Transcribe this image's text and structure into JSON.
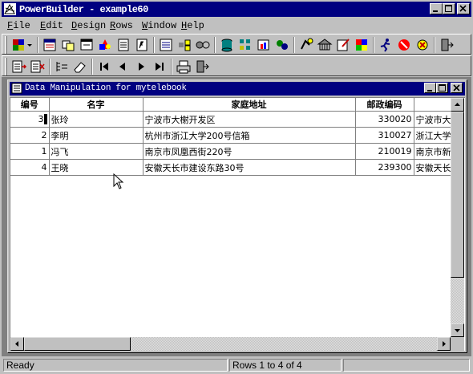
{
  "window": {
    "title": "PowerBuilder - example60",
    "app_icon": "powerbuilder-icon"
  },
  "menu": [
    {
      "label": "File",
      "key": "F",
      "rest": "ile"
    },
    {
      "label": "Edit",
      "key": "E",
      "rest": "dit"
    },
    {
      "label": "Design",
      "key": "D",
      "rest": "esign"
    },
    {
      "label": "Rows",
      "key": "R",
      "rest": "ows"
    },
    {
      "label": "Window",
      "key": "W",
      "rest": "indow"
    },
    {
      "label": "Help",
      "key": "H",
      "rest": "elp"
    }
  ],
  "toolbar1_icons": [
    "painterbar-icon",
    "datawindow-icon",
    "application-icon",
    "window-icon",
    "menu-icon",
    "structure-icon",
    "function-icon",
    "library-icon",
    "query-icon",
    "pipeline-icon",
    "database-icon",
    "dbprofile-icon",
    "project-icon",
    "userobject-icon",
    "run-icon",
    "debug-icon",
    "object-browser-icon",
    "edit-icon",
    "color-icon",
    "run-window-icon",
    "stop-icon",
    "preview-icon",
    "exit-icon"
  ],
  "toolbar2_icons": [
    "insert-row-icon",
    "delete-row-icon",
    "filter-icon",
    "eraser-icon",
    "first-page-icon",
    "prior-page-icon",
    "next-page-icon",
    "last-page-icon",
    "print-icon",
    "close-preview-icon"
  ],
  "child_window": {
    "title": "Data Manipulation for mytelebook"
  },
  "table": {
    "columns": [
      "编号",
      "名字",
      "家庭地址",
      "邮政编码",
      ""
    ],
    "rows": [
      {
        "id": "3",
        "name": "张玲",
        "address": "宁波市大榭开发区",
        "zip": "330020",
        "extra": "宁波市大"
      },
      {
        "id": "2",
        "name": "李明",
        "address": "杭州市浙江大学200号信箱",
        "zip": "310027",
        "extra": "浙江大学"
      },
      {
        "id": "1",
        "name": "冯飞",
        "address": "南京市凤凰西街220号",
        "zip": "210019",
        "extra": "南京市新"
      },
      {
        "id": "4",
        "name": "王晓",
        "address": "安徽天长市建设东路30号",
        "zip": "239300",
        "extra": "安徽天长"
      }
    ]
  },
  "status": {
    "message": "Ready",
    "rows_info": "Rows 1 to 4 of 4"
  }
}
